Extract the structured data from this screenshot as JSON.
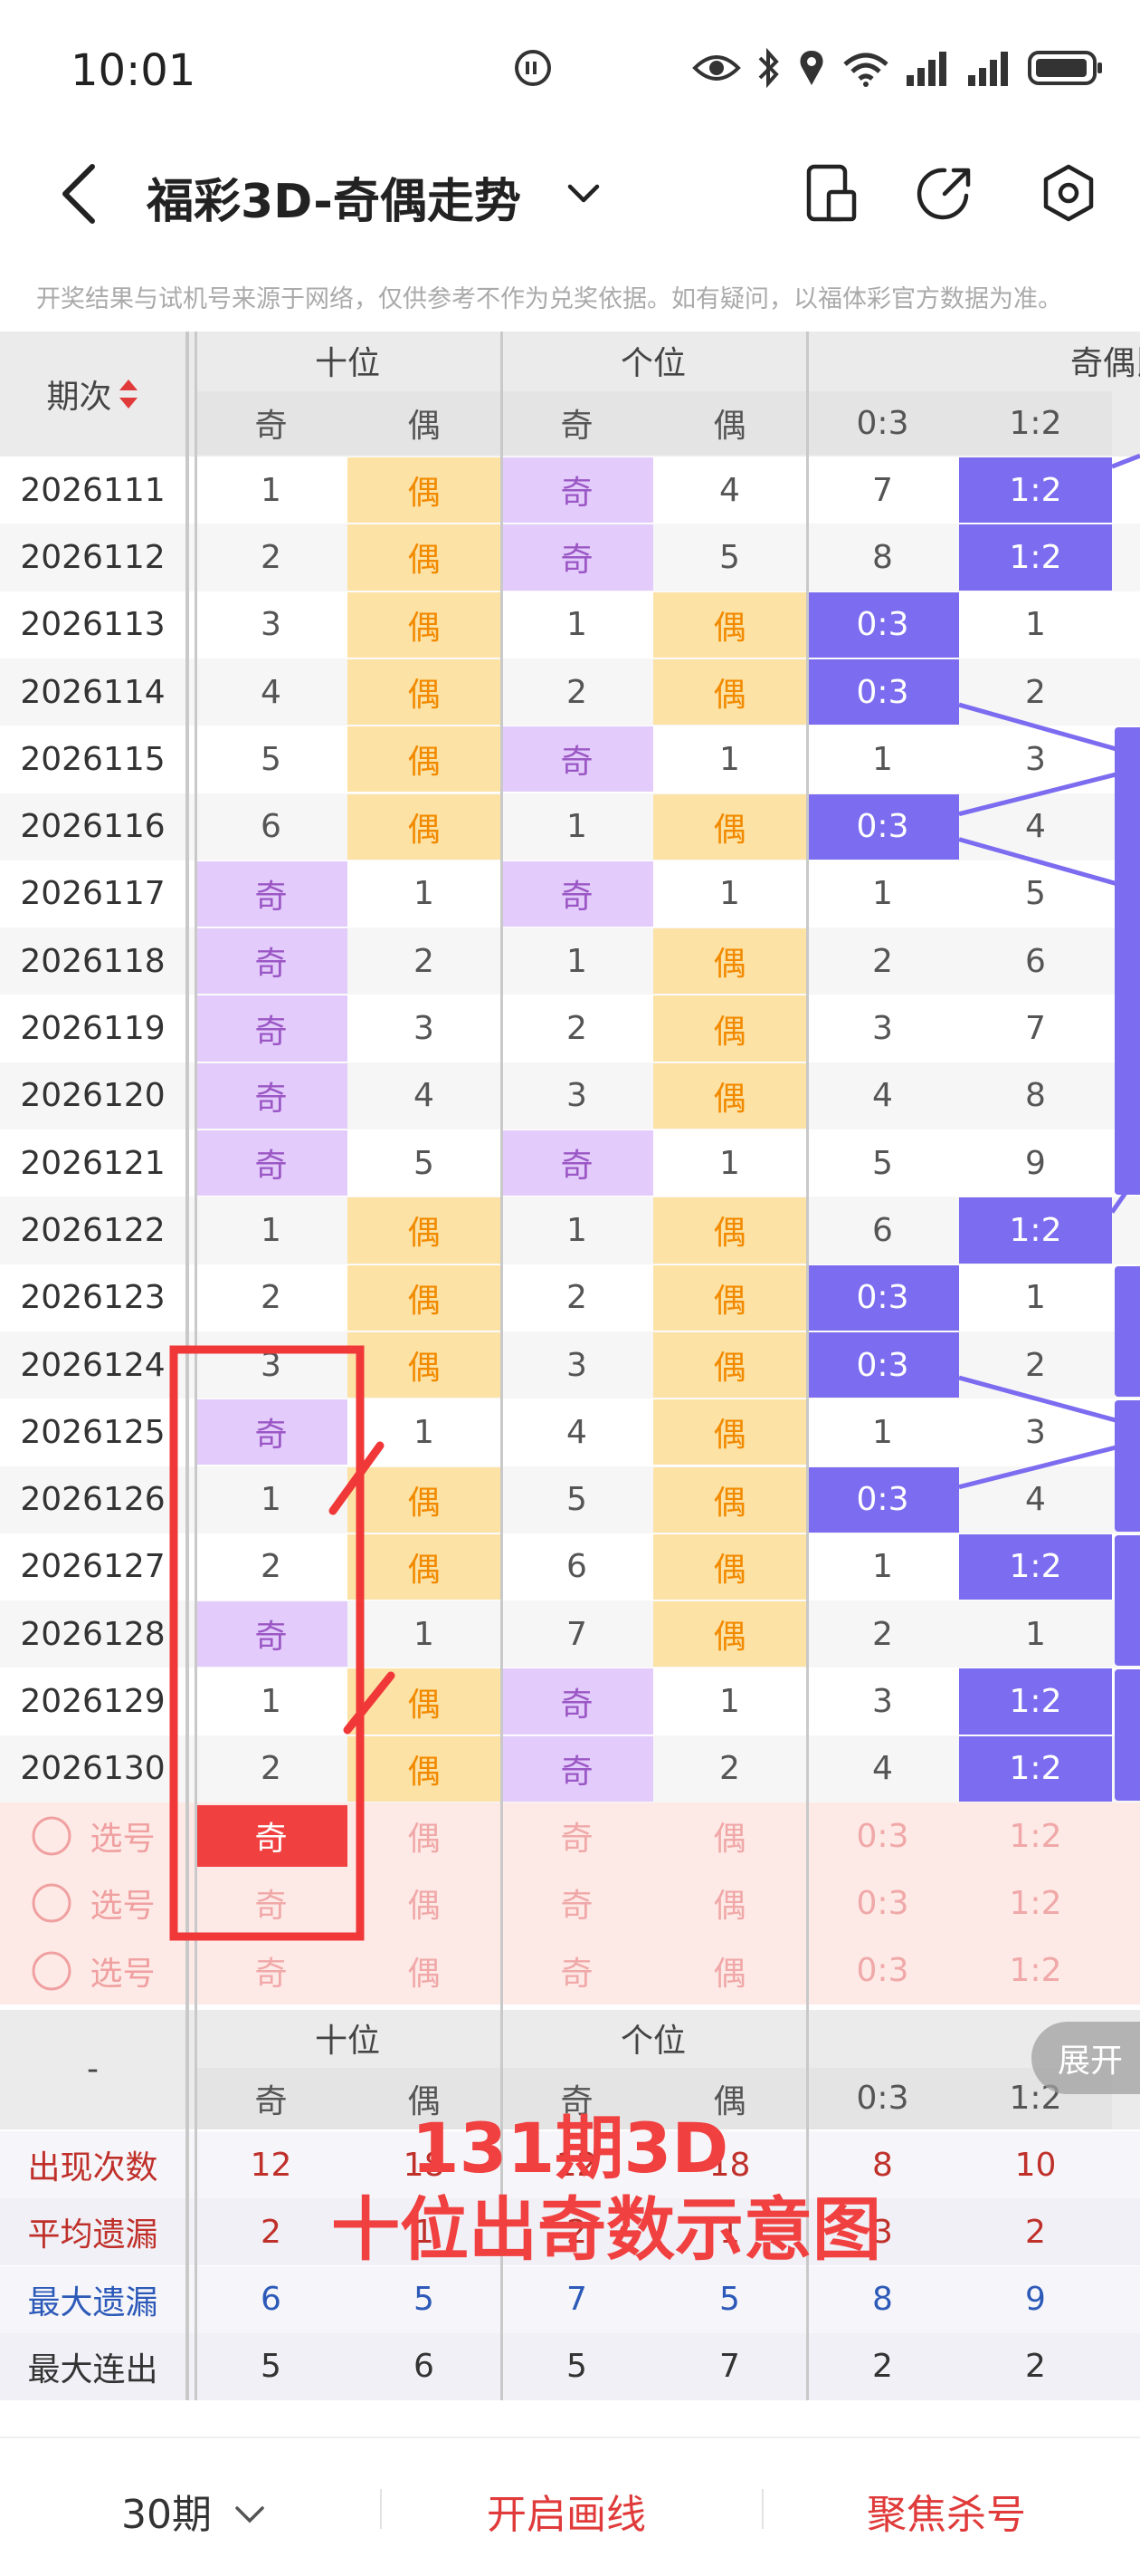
{
  "status": {
    "time": "10:01"
  },
  "header": {
    "title": "福彩3D-奇偶走势"
  },
  "disclaimer": "开奖结果与试机号来源于网络，仅供参考不作为兑奖依据。如有疑问，以福体彩官方数据为准。",
  "table": {
    "period_label": "期次",
    "group_shi": "十位",
    "group_ge": "个位",
    "group_ratio": "奇偶比",
    "sub_odd": "奇",
    "sub_even": "偶",
    "ratio_03": "0:3",
    "ratio_12": "1:2",
    "rows": [
      {
        "p": "2026111",
        "so": "1",
        "se": "偶",
        "go": "奇",
        "ge": "4",
        "r03": "7",
        "r12": "1:2"
      },
      {
        "p": "2026112",
        "so": "2",
        "se": "偶",
        "go": "奇",
        "ge": "5",
        "r03": "8",
        "r12": "1:2"
      },
      {
        "p": "2026113",
        "so": "3",
        "se": "偶",
        "go": "1",
        "ge": "偶",
        "r03": "0:3",
        "r12": "1"
      },
      {
        "p": "2026114",
        "so": "4",
        "se": "偶",
        "go": "2",
        "ge": "偶",
        "r03": "0:3",
        "r12": "2"
      },
      {
        "p": "2026115",
        "so": "5",
        "se": "偶",
        "go": "奇",
        "ge": "1",
        "r03": "1",
        "r12": "3"
      },
      {
        "p": "2026116",
        "so": "6",
        "se": "偶",
        "go": "1",
        "ge": "偶",
        "r03": "0:3",
        "r12": "4"
      },
      {
        "p": "2026117",
        "so": "奇",
        "se": "1",
        "go": "奇",
        "ge": "1",
        "r03": "1",
        "r12": "5"
      },
      {
        "p": "2026118",
        "so": "奇",
        "se": "2",
        "go": "1",
        "ge": "偶",
        "r03": "2",
        "r12": "6"
      },
      {
        "p": "2026119",
        "so": "奇",
        "se": "3",
        "go": "2",
        "ge": "偶",
        "r03": "3",
        "r12": "7"
      },
      {
        "p": "2026120",
        "so": "奇",
        "se": "4",
        "go": "3",
        "ge": "偶",
        "r03": "4",
        "r12": "8"
      },
      {
        "p": "2026121",
        "so": "奇",
        "se": "5",
        "go": "奇",
        "ge": "1",
        "r03": "5",
        "r12": "9"
      },
      {
        "p": "2026122",
        "so": "1",
        "se": "偶",
        "go": "1",
        "ge": "偶",
        "r03": "6",
        "r12": "1:2"
      },
      {
        "p": "2026123",
        "so": "2",
        "se": "偶",
        "go": "2",
        "ge": "偶",
        "r03": "0:3",
        "r12": "1"
      },
      {
        "p": "2026124",
        "so": "3",
        "se": "偶",
        "go": "3",
        "ge": "偶",
        "r03": "0:3",
        "r12": "2"
      },
      {
        "p": "2026125",
        "so": "奇",
        "se": "1",
        "go": "4",
        "ge": "偶",
        "r03": "1",
        "r12": "3"
      },
      {
        "p": "2026126",
        "so": "1",
        "se": "偶",
        "go": "5",
        "ge": "偶",
        "r03": "0:3",
        "r12": "4"
      },
      {
        "p": "2026127",
        "so": "2",
        "se": "偶",
        "go": "6",
        "ge": "偶",
        "r03": "1",
        "r12": "1:2"
      },
      {
        "p": "2026128",
        "so": "奇",
        "se": "1",
        "go": "7",
        "ge": "偶",
        "r03": "2",
        "r12": "1"
      },
      {
        "p": "2026129",
        "so": "1",
        "se": "偶",
        "go": "奇",
        "ge": "1",
        "r03": "3",
        "r12": "1:2"
      },
      {
        "p": "2026130",
        "so": "2",
        "se": "偶",
        "go": "奇",
        "ge": "2",
        "r03": "4",
        "r12": "1:2"
      }
    ],
    "select_label": "选号",
    "stats_dash": "-",
    "stats": [
      {
        "label": "出现次数",
        "color": "#c0302a",
        "vals": [
          "12",
          "18",
          "12",
          "18",
          "8",
          "10"
        ]
      },
      {
        "label": "平均遗漏",
        "color": "#c0302a",
        "vals": [
          "2",
          "1",
          "2",
          "1",
          "3",
          "2"
        ]
      },
      {
        "label": "最大遗漏",
        "color": "#2d5ab8",
        "vals": [
          "6",
          "5",
          "7",
          "5",
          "8",
          "9"
        ]
      },
      {
        "label": "最大连出",
        "color": "#333333",
        "vals": [
          "5",
          "6",
          "5",
          "7",
          "2",
          "2"
        ]
      }
    ]
  },
  "overlay": {
    "line1": "131期3D",
    "line2": "十位出奇数示意图"
  },
  "expand_label": "展开",
  "nav": {
    "period": "30期",
    "draw_line": "开启画线",
    "focus_kill": "聚焦杀号"
  },
  "colors": {
    "odd_text": "#9b57c5",
    "even_text": "#f28a00",
    "odd_bg": "#e3ccfb",
    "even_bg": "#fde2a6",
    "ratio_bg": "#7b6cf0",
    "accent_red": "#f04040"
  }
}
